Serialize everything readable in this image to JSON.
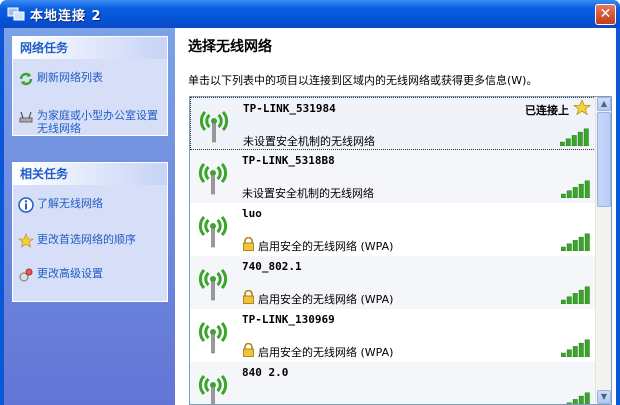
{
  "window": {
    "title": "本地连接 2",
    "close": "✕"
  },
  "tasks": {
    "network_header": "网络任务",
    "refresh_label": "刷新网络列表",
    "setup_label": "为家庭或小型办公室设置无线网络",
    "related_header": "相关任务",
    "learn_label": "了解无线网络",
    "order_label": "更改首选网络的顺序",
    "advanced_label": "更改高级设置"
  },
  "main": {
    "heading": "选择无线网络",
    "instruction": "单击以下列表中的项目以连接到区域内的无线网络或获得更多信息(W)。"
  },
  "networks": [
    {
      "ssid": "TP-LINK_531984",
      "desc": "未设置安全机制的无线网络",
      "status": "已连接上",
      "secured": false,
      "signal_bars": 5
    },
    {
      "ssid": "TP-LINK_5318B8",
      "desc": "未设置安全机制的无线网络",
      "secured": false,
      "signal_bars": 5
    },
    {
      "ssid": "luo",
      "desc": "启用安全的无线网络 (WPA)",
      "secured": true,
      "signal_bars": 5
    },
    {
      "ssid": "740_802.1",
      "desc": "启用安全的无线网络 (WPA)",
      "secured": true,
      "signal_bars": 5
    },
    {
      "ssid": "TP-LINK_130969",
      "desc": "启用安全的无线网络 (WPA)",
      "secured": true,
      "signal_bars": 5
    },
    {
      "ssid": "840 2.0",
      "desc": "",
      "secured": false,
      "signal_bars": 5
    }
  ],
  "colors": {
    "title_blue": "#0552d6",
    "task_link": "#215dc6",
    "signal_green": "#3aa52a"
  }
}
